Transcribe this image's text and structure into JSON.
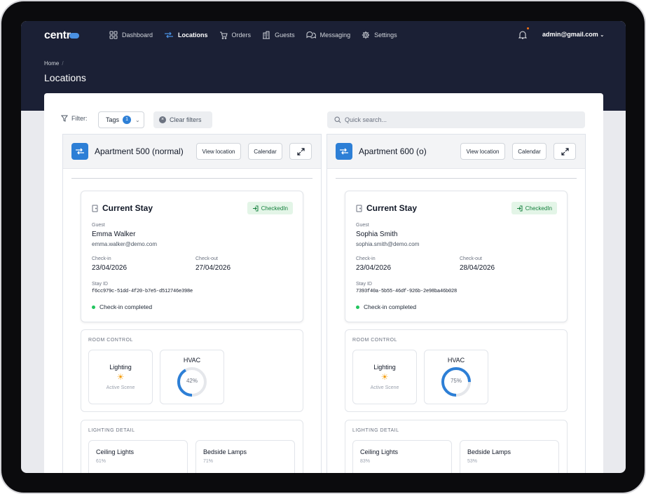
{
  "app": {
    "logo": "centr",
    "user_email": "admin@gmail.com"
  },
  "nav": [
    {
      "label": "Dashboard",
      "icon": "grid-icon",
      "active": false
    },
    {
      "label": "Locations",
      "icon": "swap-arrows-icon",
      "active": true
    },
    {
      "label": "Orders",
      "icon": "cart-icon",
      "active": false
    },
    {
      "label": "Guests",
      "icon": "building-icon",
      "active": false
    },
    {
      "label": "Messaging",
      "icon": "chat-bubbles-icon",
      "active": false
    },
    {
      "label": "Settings",
      "icon": "gear-icon",
      "active": false
    }
  ],
  "breadcrumb": {
    "home": "Home",
    "separator": "/"
  },
  "page": {
    "title": "Locations"
  },
  "filters": {
    "label": "Filter:",
    "tags_label": "Tags",
    "tags_count": "1",
    "clear_label": "Clear filters",
    "search_placeholder": "Quick search..."
  },
  "panel_buttons": {
    "view": "View location",
    "calendar": "Calendar"
  },
  "labels": {
    "current_stay": "Current Stay",
    "guest": "Guest",
    "check_in": "Check-in",
    "check_out": "Check-out",
    "stay_id": "Stay ID",
    "room_control": "ROOM CONTROL",
    "lighting": "Lighting",
    "active_scene": "Active Scene",
    "hvac": "HVAC",
    "lighting_detail": "LIGHTING DETAIL"
  },
  "colors": {
    "accent": "#2d7fd6",
    "header": "#1b2035",
    "success": "#22c55e",
    "badge_bg": "#e3f5e7",
    "gauge_track": "#e5e7eb"
  },
  "locations": [
    {
      "name": "Apartment 500 (normal)",
      "status_badge": "CheckedIn",
      "guest_name": "Emma Walker",
      "guest_email": "emma.walker@demo.com",
      "check_in": "23/04/2026",
      "check_out": "27/04/2026",
      "stay_id": "f6cc979c-51dd-4f20-b7e5-d512746e398e",
      "status_text": "Check-in completed",
      "hvac_text": "42%",
      "hvac_value": 0.42,
      "lights": [
        {
          "name": "Ceiling Lights",
          "pct": "61%"
        },
        {
          "name": "Bedside Lamps",
          "pct": "71%"
        }
      ]
    },
    {
      "name": "Apartment 600 (o)",
      "status_badge": "CheckedIn",
      "guest_name": "Sophia Smith",
      "guest_email": "sophia.smith@demo.com",
      "check_in": "23/04/2026",
      "check_out": "28/04/2026",
      "stay_id": "7393f40a-5b55-46df-926b-2e98ba46b028",
      "status_text": "Check-in completed",
      "hvac_text": "75%",
      "hvac_value": 0.75,
      "lights": [
        {
          "name": "Ceiling Lights",
          "pct": "83%"
        },
        {
          "name": "Bedside Lamps",
          "pct": "53%"
        }
      ]
    }
  ]
}
